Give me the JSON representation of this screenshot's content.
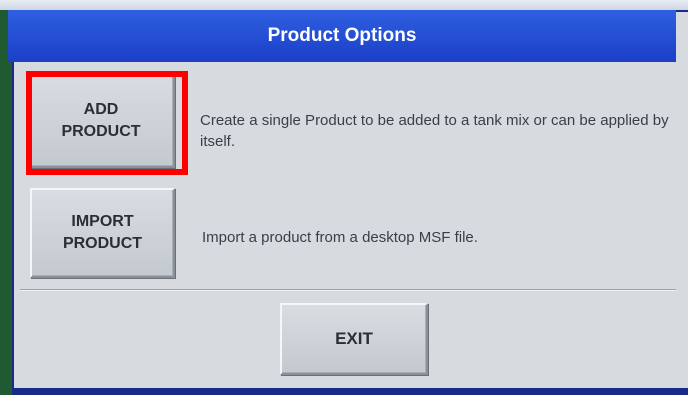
{
  "header": {
    "title": "Product Options"
  },
  "options": [
    {
      "button_label": "ADD\nPRODUCT",
      "description": "Create a single Product to be added to a tank mix or can be applied by itself."
    },
    {
      "button_label": "IMPORT\nPRODUCT",
      "description": "Import a product from a desktop MSF file."
    }
  ],
  "footer": {
    "exit_label": "EXIT"
  },
  "colors": {
    "title_bar": "#1a3fc8",
    "highlight": "#ff0000",
    "screen_bg": "#d7dbe0"
  }
}
